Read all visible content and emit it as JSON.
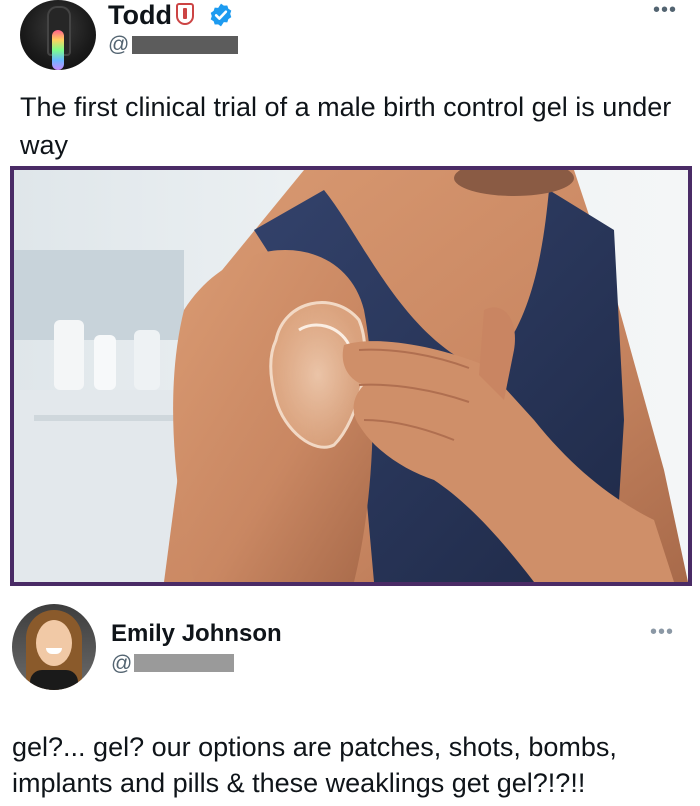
{
  "post": {
    "author_name": "Todd",
    "handle_prefix": "@",
    "more_label": "•••",
    "text": "The first clinical trial of a male birth control gel is under way"
  },
  "reply": {
    "author_name": "Emily Johnson",
    "handle_prefix": "@",
    "more_label": "•••",
    "text": "gel?... gel? our options are patches, shots, bombs, implants and pills & these weaklings get gel?!?!!"
  },
  "colors": {
    "verified_badge": "#1d9bf0",
    "photo_frame": "#4a2b66",
    "tank_top": "#2c3a60"
  },
  "icons": [
    "shield-icon",
    "verified-badge-icon",
    "more-options-icon"
  ]
}
